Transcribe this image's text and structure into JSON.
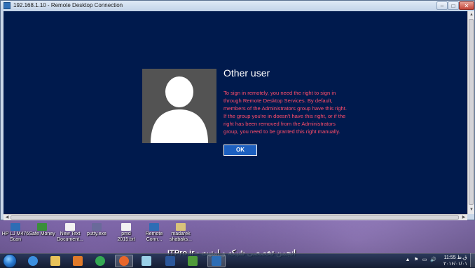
{
  "window": {
    "title": "192.168.1.10 - Remote Desktop Connection",
    "minimize_glyph": "–",
    "maximize_glyph": "□",
    "close_glyph": "✕"
  },
  "dialog": {
    "title": "Other user",
    "message": "To sign in remotely, you need the right to sign in through Remote Desktop Services. By default, members of the Administrators group have this right. If the group you're in doesn't have this right, or if the right has been removed from the Administrators group, you need to be granted this right manually.",
    "ok_label": "OK"
  },
  "desktop_icons": [
    {
      "label": "HP LJ M476 Scan",
      "color": "#2d6db5"
    },
    {
      "label": "Safe Money",
      "color": "#3a8f3a"
    },
    {
      "label": "New Text Document...",
      "color": "#f2f2f2"
    },
    {
      "label": "putty.exe",
      "color": "#6a6a9a"
    },
    {
      "label": "pmd 2015.txt",
      "color": "#f2f2f2"
    },
    {
      "label": "Remote Conn...",
      "color": "#2d6db5"
    },
    {
      "label": "madarek shabaks...",
      "color": "#d9c27a"
    }
  ],
  "watermark": "ITPro.ir - انجمن تخصصی شبکه و امنیت",
  "taskbar": {
    "apps": [
      {
        "name": "internet-explorer",
        "color": "#3b8fe0"
      },
      {
        "name": "file-explorer",
        "color": "#e8c25a"
      },
      {
        "name": "media-player",
        "color": "#e07a2a"
      },
      {
        "name": "chrome",
        "color": "#34a853"
      },
      {
        "name": "firefox",
        "color": "#e8662a"
      },
      {
        "name": "notepad",
        "color": "#9ad0e8"
      },
      {
        "name": "word",
        "color": "#2b579a"
      },
      {
        "name": "excel-like",
        "color": "#4f9a3a"
      },
      {
        "name": "remote-desktop",
        "color": "#2d6db5"
      }
    ],
    "tray_symbols": [
      "▲",
      "⚑",
      "▭",
      "🔊"
    ],
    "clock_time": "11:55 ق.ظ",
    "clock_date": "۲۰۱۶/۰۱/۰۱"
  }
}
